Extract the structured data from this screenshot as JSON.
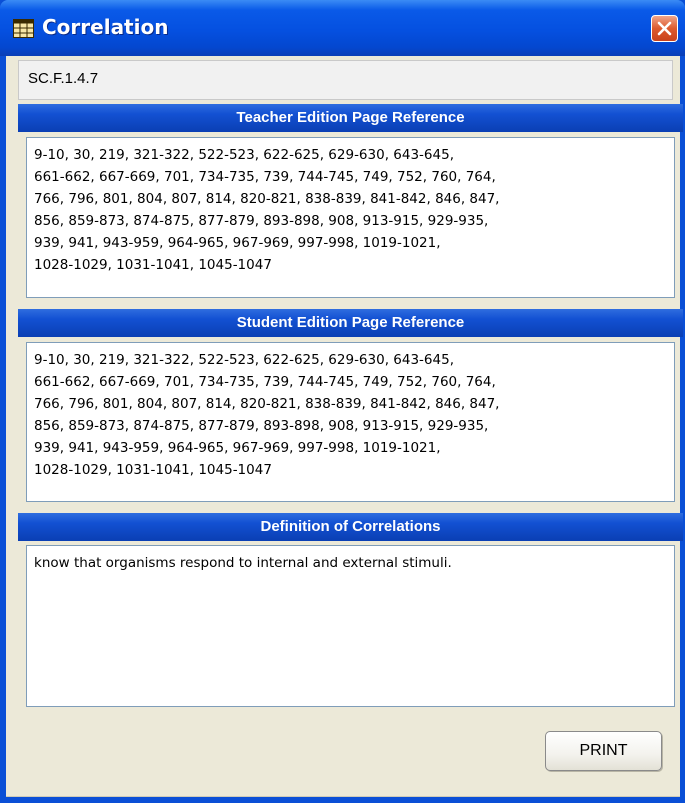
{
  "window": {
    "title": "Correlation",
    "icon": "grid-app-icon",
    "close_icon": "close-x-icon"
  },
  "standard_code": "SC.F.1.4.7",
  "sections": [
    {
      "header": "Teacher Edition Page Reference",
      "content": "9-10, 30, 219, 321-322, 522-523, 622-625, 629-630, 643-645,\n661-662, 667-669, 701, 734-735, 739, 744-745, 749, 752, 760, 764,\n766, 796, 801, 804, 807, 814, 820-821, 838-839, 841-842, 846, 847,\n856, 859-873, 874-875, 877-879, 893-898, 908, 913-915, 929-935,\n939, 941, 943-959, 964-965, 967-969, 997-998, 1019-1021,\n1028-1029, 1031-1041, 1045-1047"
    },
    {
      "header": "Student Edition Page Reference",
      "content": "9-10, 30, 219, 321-322, 522-523, 622-625, 629-630, 643-645,\n661-662, 667-669, 701, 734-735, 739, 744-745, 749, 752, 760, 764,\n766, 796, 801, 804, 807, 814, 820-821, 838-839, 841-842, 846, 847,\n856, 859-873, 874-875, 877-879, 893-898, 908, 913-915, 929-935,\n939, 941, 943-959, 964-965, 967-969, 997-998, 1019-1021,\n1028-1029, 1031-1041, 1045-1047"
    },
    {
      "header": "Definition of Correlations",
      "content": "know that organisms respond to internal and external stimuli."
    }
  ],
  "buttons": {
    "print": "PRINT"
  },
  "colors": {
    "title_bar": "#0550e0",
    "section_header": "#1351d3",
    "dialog_background": "#ece9d8",
    "close_button": "#dd5a2e"
  }
}
